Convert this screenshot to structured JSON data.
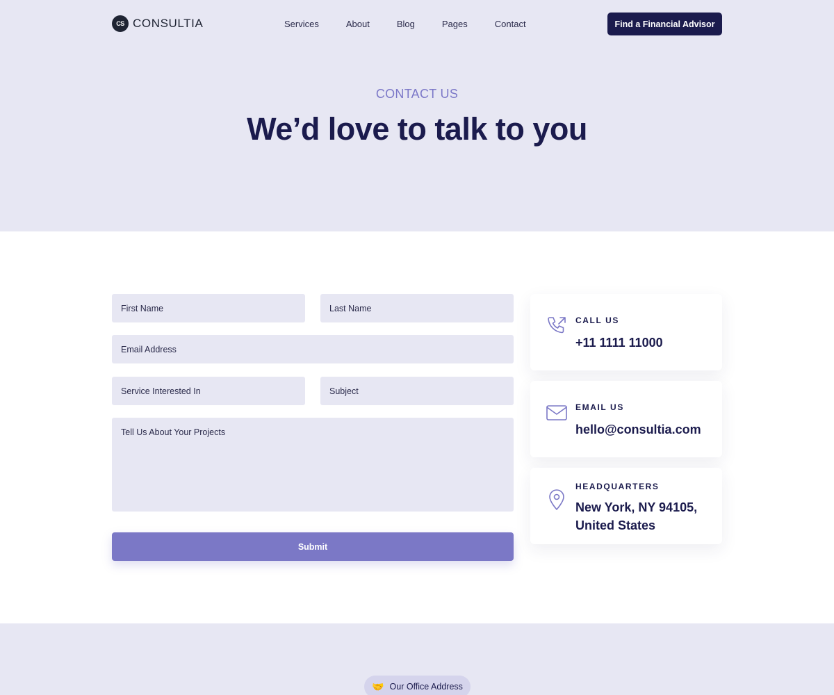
{
  "brand": {
    "name": "CONSULTIA",
    "mark": "CS"
  },
  "nav": {
    "links": [
      "Services",
      "About",
      "Blog",
      "Pages",
      "Contact"
    ],
    "cta": "Find a Financial Advisor"
  },
  "hero": {
    "eyebrow": "CONTACT US",
    "title": "We’d love to talk to you"
  },
  "form": {
    "first_name_placeholder": "First Name",
    "last_name_placeholder": "Last Name",
    "email_placeholder": "Email Address",
    "service_placeholder": "Service Interested In",
    "subject_placeholder": "Subject",
    "message_placeholder": "Tell Us About Your Projects",
    "submit_label": "Submit"
  },
  "contact_cards": {
    "call": {
      "label": "CALL US",
      "value": "+11 1111 11000",
      "icon": "phone-icon"
    },
    "email": {
      "label": "EMAIL US",
      "value": "hello@consultia.com",
      "icon": "mail-icon"
    },
    "hq": {
      "label": "HEADQUARTERS",
      "value": "New York, NY 94105, United States",
      "icon": "map-pin-icon"
    }
  },
  "bottom": {
    "pill_label": "Our Office Address",
    "pill_icon": "handshake-icon"
  },
  "colors": {
    "hero_bg": "#e7e7f3",
    "primary_dark": "#1b1b4d",
    "accent": "#7b78c6"
  }
}
